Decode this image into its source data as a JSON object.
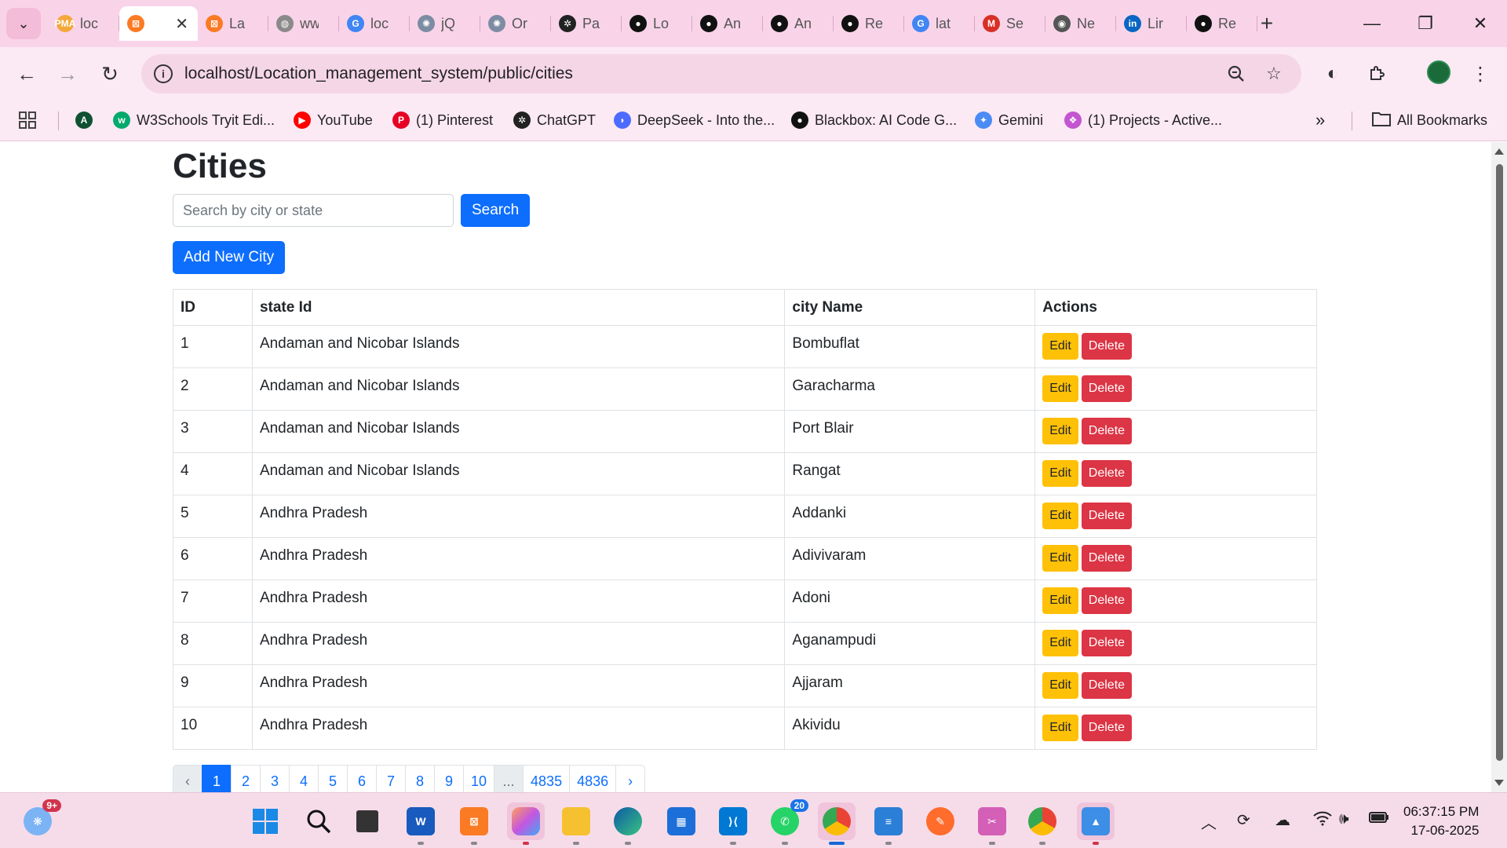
{
  "browser": {
    "tabs": [
      {
        "title": "loc",
        "icon": "phpmyadmin-icon",
        "color": "#f4a83a",
        "glyph": "PMA",
        "active": false
      },
      {
        "title": "",
        "icon": "xampp-icon",
        "color": "#fb7a24",
        "glyph": "⊠",
        "active": true
      },
      {
        "title": "La",
        "icon": "xampp-icon",
        "color": "#fb7a24",
        "glyph": "⊠",
        "active": false
      },
      {
        "title": "ww",
        "icon": "globe-icon",
        "color": "#8a8a8a",
        "glyph": "◍",
        "active": false
      },
      {
        "title": "loc",
        "icon": "google-icon",
        "color": "#4285f4",
        "glyph": "G",
        "active": false
      },
      {
        "title": "jQ",
        "icon": "owl-icon",
        "color": "#7d8ca3",
        "glyph": "✺",
        "active": false
      },
      {
        "title": "Or",
        "icon": "owl-icon",
        "color": "#7d8ca3",
        "glyph": "✺",
        "active": false
      },
      {
        "title": "Pa",
        "icon": "openai-icon",
        "color": "#222222",
        "glyph": "✲",
        "active": false
      },
      {
        "title": "Lo",
        "icon": "github-icon",
        "color": "#111111",
        "glyph": "●",
        "active": false
      },
      {
        "title": "An",
        "icon": "github-icon",
        "color": "#111111",
        "glyph": "●",
        "active": false
      },
      {
        "title": "An",
        "icon": "github-icon",
        "color": "#111111",
        "glyph": "●",
        "active": false
      },
      {
        "title": "Re",
        "icon": "github-icon",
        "color": "#111111",
        "glyph": "●",
        "active": false
      },
      {
        "title": "lat",
        "icon": "google-icon",
        "color": "#4285f4",
        "glyph": "G",
        "active": false
      },
      {
        "title": "Se",
        "icon": "gmail-icon",
        "color": "#d93025",
        "glyph": "M",
        "active": false
      },
      {
        "title": "Ne",
        "icon": "chrome-icon",
        "color": "#555555",
        "glyph": "◉",
        "active": false
      },
      {
        "title": "Lir",
        "icon": "linkedin-icon",
        "color": "#0a66c2",
        "glyph": "in",
        "active": false
      },
      {
        "title": "Re",
        "icon": "github-icon",
        "color": "#111111",
        "glyph": "●",
        "active": false
      }
    ],
    "url": "localhost/Location_management_system/public/cities",
    "bookmarks": [
      {
        "label": "",
        "icon": "font-a-icon",
        "color": "#0f5132",
        "glyph": "A"
      },
      {
        "label": "W3Schools Tryit Edi...",
        "icon": "w3schools-icon",
        "color": "#04aa6d",
        "glyph": "w"
      },
      {
        "label": "YouTube",
        "icon": "youtube-icon",
        "color": "#ff0000",
        "glyph": "▶"
      },
      {
        "label": "(1) Pinterest",
        "icon": "pinterest-icon",
        "color": "#e60023",
        "glyph": "P"
      },
      {
        "label": "ChatGPT",
        "icon": "openai-icon",
        "color": "#222222",
        "glyph": "✲"
      },
      {
        "label": "DeepSeek - Into the...",
        "icon": "deepseek-icon",
        "color": "#4d6bfe",
        "glyph": "◗"
      },
      {
        "label": "Blackbox: AI Code G...",
        "icon": "blackbox-icon",
        "color": "#111111",
        "glyph": "●"
      },
      {
        "label": "Gemini",
        "icon": "gemini-icon",
        "color": "#4b8bf5",
        "glyph": "✦"
      },
      {
        "label": "(1) Projects - Active...",
        "icon": "projects-icon",
        "color": "#c355d1",
        "glyph": "❖"
      }
    ],
    "all_bookmarks": "All Bookmarks"
  },
  "page": {
    "title": "Cities",
    "search": {
      "placeholder": "Search by city or state",
      "value": "",
      "button": "Search"
    },
    "add_button": "Add New City",
    "table": {
      "headers": [
        "ID",
        "state Id",
        "city Name",
        "Actions"
      ],
      "rows": [
        {
          "id": "1",
          "state": "Andaman and Nicobar Islands",
          "city": "Bombuflat"
        },
        {
          "id": "2",
          "state": "Andaman and Nicobar Islands",
          "city": "Garacharma"
        },
        {
          "id": "3",
          "state": "Andaman and Nicobar Islands",
          "city": "Port Blair"
        },
        {
          "id": "4",
          "state": "Andaman and Nicobar Islands",
          "city": "Rangat"
        },
        {
          "id": "5",
          "state": "Andhra Pradesh",
          "city": "Addanki"
        },
        {
          "id": "6",
          "state": "Andhra Pradesh",
          "city": "Adivivaram"
        },
        {
          "id": "7",
          "state": "Andhra Pradesh",
          "city": "Adoni"
        },
        {
          "id": "8",
          "state": "Andhra Pradesh",
          "city": "Aganampudi"
        },
        {
          "id": "9",
          "state": "Andhra Pradesh",
          "city": "Ajjaram"
        },
        {
          "id": "10",
          "state": "Andhra Pradesh",
          "city": "Akividu"
        }
      ],
      "edit_label": "Edit",
      "delete_label": "Delete"
    },
    "pagination": {
      "prev": "‹",
      "pages": [
        "1",
        "2",
        "3",
        "4",
        "5",
        "6",
        "7",
        "8",
        "9",
        "10",
        "...",
        "4835",
        "4836"
      ],
      "current": "1",
      "next": "›"
    }
  },
  "taskbar": {
    "notification_badge": "9+",
    "whatsapp_badge": "20",
    "time": "06:37:15 PM",
    "date": "17-06-2025"
  },
  "colors": {
    "primary": "#0d6efd",
    "warning": "#ffc107",
    "danger": "#dc3545",
    "chrome_pink": "#f9d4e9"
  }
}
